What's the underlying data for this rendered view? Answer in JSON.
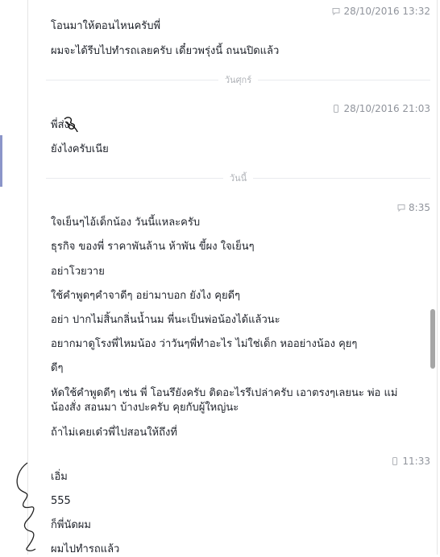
{
  "timestamps": {
    "t1": "28/10/2016 13:32",
    "t2": "28/10/2016 21:03",
    "t3": "8:35",
    "t4": "11:33"
  },
  "separators": {
    "friday": "วันศุกร์",
    "today": "วันนี้"
  },
  "messages": [
    "โอนมาให้ตอนไหนครับพี่",
    "ผมจะได้รีบไปทำรถเลยครับ เดี๋ยวพรุ่งนี้ ถนนปิดแล้ว",
    "พี่ส่ง",
    "ยังไงครับเนีย",
    "ใจเย็นๆไอ้เด็กน้อง วันนี้แหละครับ",
    "ธุรกิจ ของพี่ ราคาพันล้าน ห้าพัน ขี้ผง ใจเย็นๆ",
    "อย่าโวยวาย",
    "ใช้คำพูดๆคำจาดีๆ อย่ามาบอก ยังไง คุยดีๆ",
    "อย่า ปากไม่สิ้นกลิ่นน้ำนม พี่นะเป็นพ่อน้องได้แล้วนะ",
    "อยากมาดูโรงพี่ไหมน้อง ว่าวันๆพี่ทำอะไร ไม่ใช่เด็ก หออย่างน้อง คุยๆ",
    "ดีๆ",
    "หัดใช้คำพูดดีๆ เช่น พี่ โอนรึยังครับ ติดอะไรรึเปล่าครับ เอาตรงๆเลยนะ พ่อ แม่ น้องสั่ง สอนมา บ้างปะครับ คุยกับผู้ใหญ่นะ",
    "ถ้าไม่เคยเด๋วพี่ไปสอนให้ถึงที่",
    "เอิ่ม",
    "555",
    "ก็พี่นัดผม",
    "ผมไปทำรถแล้ว"
  ],
  "colors": {
    "text": "#1d2129",
    "timestamp": "#90949c",
    "separator_line": "#e9ebee",
    "scrollbar": "#a6a6a6",
    "accent": "#8b95c9"
  }
}
